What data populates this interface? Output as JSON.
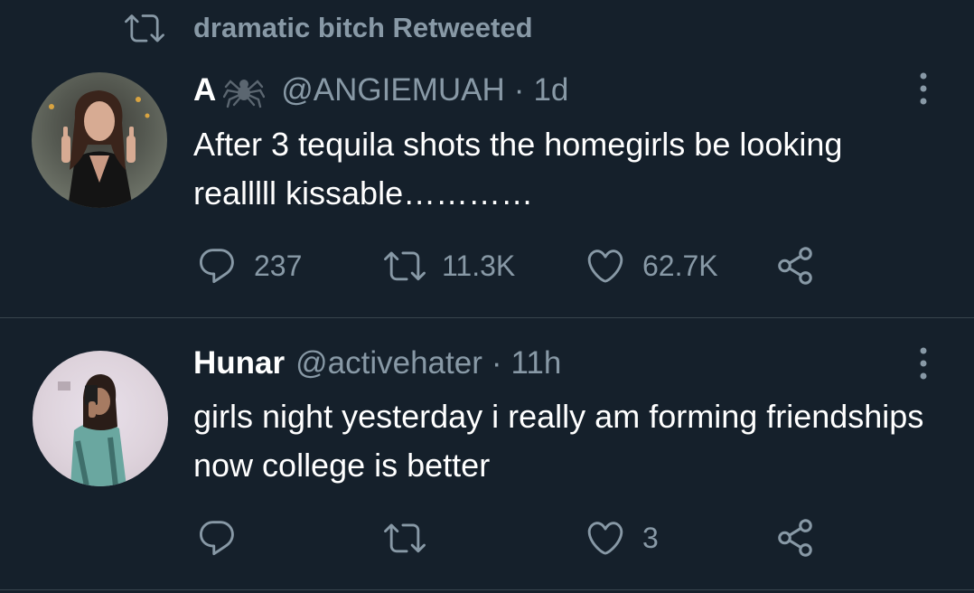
{
  "colors": {
    "background": "#15202b",
    "primary_text": "#ffffff",
    "secondary_text": "#8899a6",
    "divider": "#38444d"
  },
  "retweet_banner": {
    "icon": "retweet-icon",
    "text": "dramatic bitch Retweeted"
  },
  "tweets": [
    {
      "avatar": "avatar-photo",
      "display_name": "A",
      "name_emoji": "spider-icon",
      "handle": "@ANGIEMUAH",
      "separator": "·",
      "time": "1d",
      "text": "After 3 tequila shots the homegirls be looking realllll kissable…………",
      "reply_count": "237",
      "retweet_count": "11.3K",
      "like_count": "62.7K"
    },
    {
      "avatar": "avatar-photo",
      "display_name": "Hunar",
      "handle": "@activehater",
      "separator": "·",
      "time": "11h",
      "text": "girls night yesterday i really am forming friendships now college is better",
      "reply_count": "",
      "retweet_count": "",
      "like_count": "3"
    }
  ]
}
